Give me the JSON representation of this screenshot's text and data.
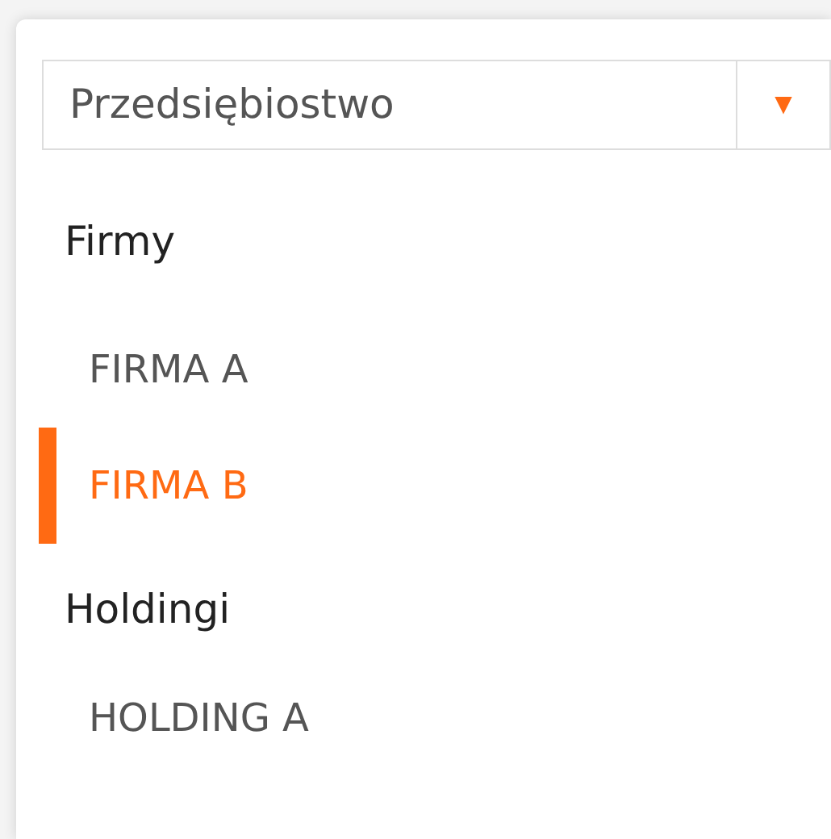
{
  "select": {
    "value": "Przedsiębiostwo",
    "caret": "▼"
  },
  "groups": [
    {
      "label": "Firmy",
      "items": [
        {
          "label": "FIRMA A",
          "selected": false
        },
        {
          "label": "FIRMA B",
          "selected": true
        }
      ]
    },
    {
      "label": "Holdingi",
      "items": [
        {
          "label": "HOLDING A",
          "selected": false
        }
      ]
    }
  ]
}
